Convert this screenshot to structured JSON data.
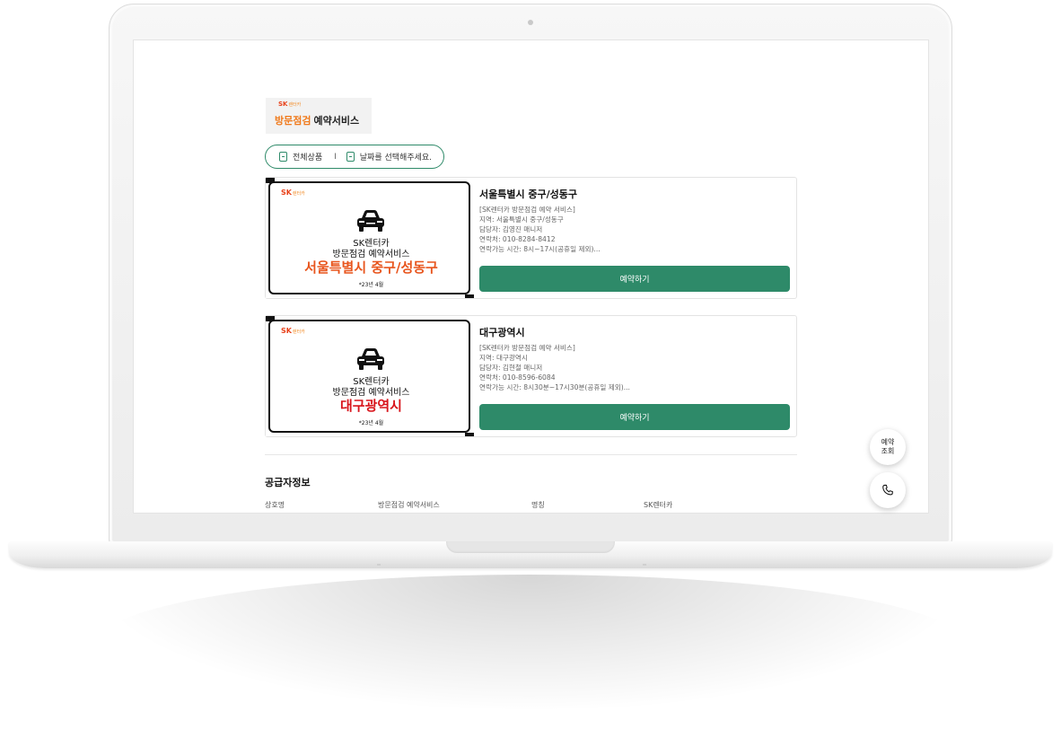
{
  "brand": {
    "sk_logo": "SK",
    "sk_logo_sub": "렌터카",
    "title_orange": "방문점검",
    "title_black": "예약서비스"
  },
  "filter": {
    "all_products": "전체상품",
    "separator": "I",
    "date_placeholder": "날짜를 선택해주세요."
  },
  "products": [
    {
      "thumb_brand": "SK",
      "thumb_brand_sub": "렌터카",
      "thumb_line1": "SK렌터카",
      "thumb_line2": "방문점검 예약서비스",
      "thumb_region": "서울특별시 중구/성동구",
      "thumb_region_color": "#e8551d",
      "thumb_date": "*23년 4월",
      "title": "서울특별시 중구/성동구",
      "desc": [
        "[SK렌터카 방문점검 예약 서비스]",
        "지역: 서울특별시 중구/성동구",
        "담당자: 김영진 매니저",
        "연락처: 010-8284-8412",
        "연락가능 시간: 8시~17시(공휴일 제외)..."
      ],
      "button": "예약하기"
    },
    {
      "thumb_brand": "SK",
      "thumb_brand_sub": "렌터카",
      "thumb_line1": "SK렌터카",
      "thumb_line2": "방문점검 예약서비스",
      "thumb_region": "대구광역시",
      "thumb_region_color": "#d8141b",
      "thumb_date": "*23년 4월",
      "title": "대구광역시",
      "desc": [
        "[SK렌터카 방문점검 예약 서비스]",
        "지역: 대구광역시",
        "담당자: 김현철 매니저",
        "연락처: 010-8596-6084",
        "연락가능 시간: 8시30분~17시30분(공휴일 제외)..."
      ],
      "button": "예약하기"
    }
  ],
  "supplier": {
    "title": "공급자정보",
    "row": [
      "상호명",
      "방문점검 예약서비스",
      "명칭",
      "SK렌터카"
    ]
  },
  "floating": {
    "reservation_lookup": "예약\n조회",
    "phone_icon": "phone-icon"
  },
  "colors": {
    "accent": "#2e8a69",
    "brand_orange": "#f07a1c",
    "brand_red": "#e8421b"
  }
}
